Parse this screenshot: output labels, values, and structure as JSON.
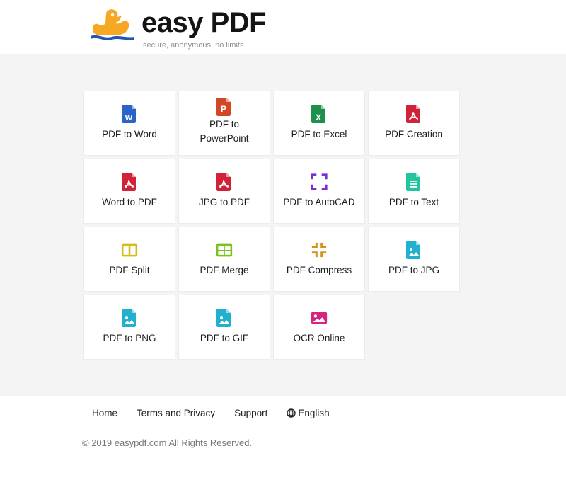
{
  "header": {
    "brand": "easy PDF",
    "tagline": "secure, anonymous, no limits",
    "logo_icon": "duck-logo-icon",
    "colors": {
      "duck": "#f7a823",
      "wave": "#1f55b3",
      "brand_text": "#141414"
    }
  },
  "tools": [
    {
      "label": "PDF to Word",
      "icon": "word-file-icon",
      "color": "#2a64c8"
    },
    {
      "label": "PDF to PowerPoint",
      "icon": "powerpoint-file-icon",
      "color": "#d24726"
    },
    {
      "label": "PDF to Excel",
      "icon": "excel-file-icon",
      "color": "#1f8f4e"
    },
    {
      "label": "PDF Creation",
      "icon": "pdf-file-icon",
      "color": "#d0233a"
    },
    {
      "label": "Word to PDF",
      "icon": "pdf-file-icon",
      "color": "#d0233a"
    },
    {
      "label": "JPG to PDF",
      "icon": "pdf-file-icon",
      "color": "#d0233a"
    },
    {
      "label": "PDF to AutoCAD",
      "icon": "expand-corners-icon",
      "color": "#7b2fd4"
    },
    {
      "label": "PDF to Text",
      "icon": "text-file-icon",
      "color": "#22c5a0"
    },
    {
      "label": "PDF Split",
      "icon": "split-columns-icon",
      "color": "#d4bc1e"
    },
    {
      "label": "PDF Merge",
      "icon": "merge-grid-icon",
      "color": "#76c51e"
    },
    {
      "label": "PDF Compress",
      "icon": "compress-corners-icon",
      "color": "#d4911e"
    },
    {
      "label": "PDF to JPG",
      "icon": "image-file-icon",
      "color": "#22b0d0"
    },
    {
      "label": "PDF to PNG",
      "icon": "image-file-icon",
      "color": "#22b0d0"
    },
    {
      "label": "PDF to GIF",
      "icon": "image-file-icon",
      "color": "#22b0d0"
    },
    {
      "label": "OCR Online",
      "icon": "picture-icon",
      "color": "#d42680"
    }
  ],
  "footer": {
    "links": [
      {
        "label": "Home"
      },
      {
        "label": "Terms and Privacy"
      },
      {
        "label": "Support"
      },
      {
        "label": "English",
        "icon": "globe-icon"
      }
    ],
    "copyright": "© 2019 easypdf.com All Rights Reserved."
  }
}
